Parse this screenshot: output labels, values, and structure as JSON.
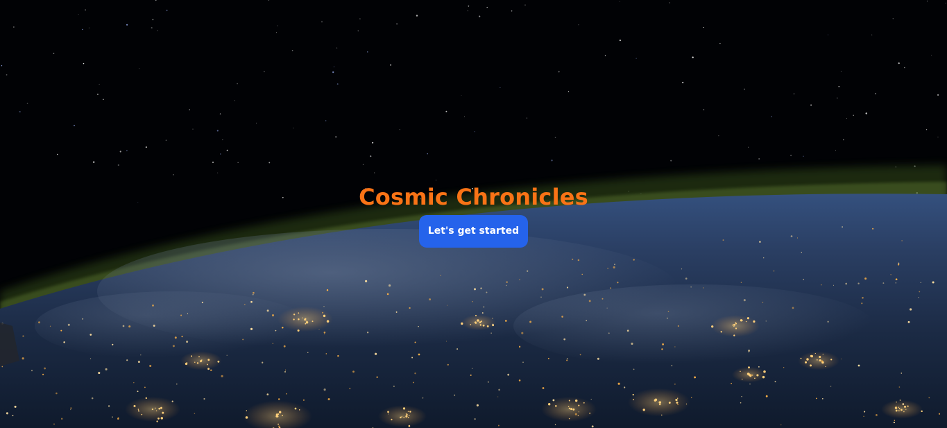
{
  "hero": {
    "title": "Cosmic Chronicles",
    "button_label": "Let's get started"
  },
  "background": {
    "image": "earth-at-night-from-orbit",
    "colors": {
      "space": "#010205",
      "atmosphere": "#5a7a2a",
      "ocean": "#1b2a44",
      "city_lights": "#ffb347"
    }
  },
  "colors": {
    "title": "#f97316",
    "button_bg": "#2563eb",
    "button_text": "#ffffff"
  }
}
